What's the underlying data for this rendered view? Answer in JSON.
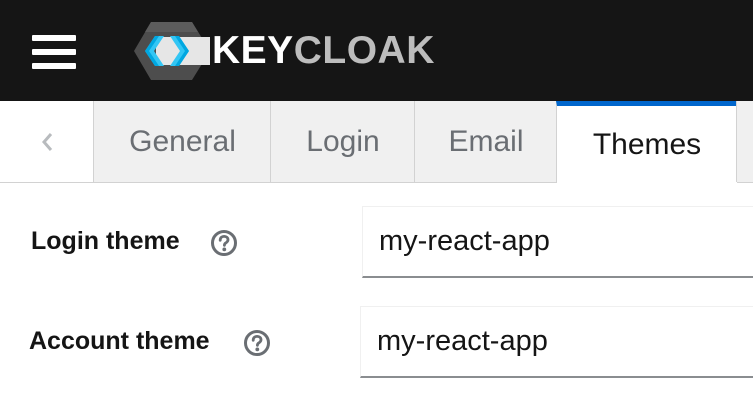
{
  "header": {
    "logo_word_part1": "KEY",
    "logo_word_part2": "CLOAK",
    "logo_icon": "keycloak-logo-icon",
    "menu_icon": "hamburger-menu-icon",
    "background": "#151515"
  },
  "tabs": {
    "scroll_icon": "chevron-left-icon",
    "items": [
      {
        "label": "General",
        "active": false
      },
      {
        "label": "Login",
        "active": false
      },
      {
        "label": "Email",
        "active": false
      },
      {
        "label": "Themes",
        "active": true
      }
    ],
    "active_color": "#0066cc"
  },
  "form": {
    "login_theme": {
      "label": "Login theme",
      "value": "my-react-app",
      "help_icon": "question-circle-icon"
    },
    "account_theme": {
      "label": "Account theme",
      "value": "my-react-app",
      "help_icon": "question-circle-icon"
    }
  }
}
